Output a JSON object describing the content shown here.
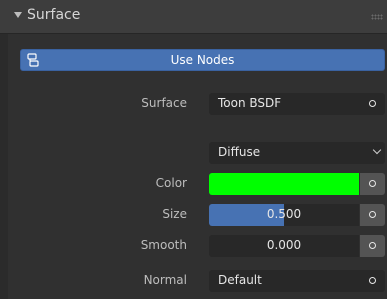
{
  "panel": {
    "title": "Surface"
  },
  "use_nodes": {
    "label": "Use Nodes"
  },
  "rows": {
    "surface": {
      "label": "Surface",
      "value": "Toon BSDF"
    },
    "component": {
      "value": "Diffuse"
    },
    "color": {
      "label": "Color",
      "value_hex": "#00ff00"
    },
    "size": {
      "label": "Size",
      "value": "0.500",
      "fraction": 0.5
    },
    "smooth": {
      "label": "Smooth",
      "value": "0.000",
      "fraction": 0.0
    },
    "normal": {
      "label": "Normal",
      "value": "Default"
    }
  },
  "colors": {
    "accent": "#4772b3",
    "swatch": "#00ff00"
  },
  "icons": [
    "chevron-down-icon",
    "grip-icon",
    "node-tree-icon",
    "socket-icon"
  ]
}
